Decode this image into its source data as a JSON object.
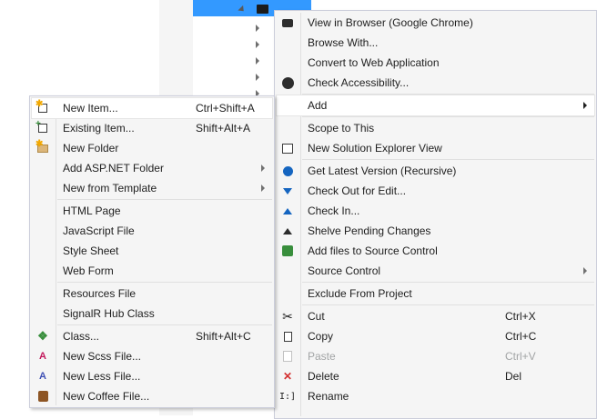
{
  "context_menu": {
    "items": [
      {
        "label": "View in Browser (Google Chrome)",
        "icon": "browser-icon"
      },
      {
        "label": "Browse With..."
      },
      {
        "label": "Convert to Web Application"
      },
      {
        "label": "Check Accessibility...",
        "icon": "accessibility-icon"
      },
      {
        "label": "Add",
        "has_submenu": true,
        "highlighted": true
      },
      {
        "label": "Scope to This"
      },
      {
        "label": "New Solution Explorer View",
        "icon": "new-view-icon"
      },
      {
        "label": "Get Latest Version (Recursive)",
        "icon": "get-latest-icon"
      },
      {
        "label": "Check Out for Edit...",
        "icon": "check-out-icon"
      },
      {
        "label": "Check In...",
        "icon": "check-in-icon"
      },
      {
        "label": "Shelve Pending Changes",
        "icon": "shelve-icon"
      },
      {
        "label": "Add files to Source Control",
        "icon": "add-source-control-icon"
      },
      {
        "label": "Source Control",
        "has_submenu": true
      },
      {
        "label": "Exclude From Project"
      },
      {
        "label": "Cut",
        "shortcut": "Ctrl+X",
        "icon": "scissors-icon"
      },
      {
        "label": "Copy",
        "shortcut": "Ctrl+C",
        "icon": "copy-icon"
      },
      {
        "label": "Paste",
        "shortcut": "Ctrl+V",
        "icon": "paste-icon",
        "disabled": true
      },
      {
        "label": "Delete",
        "shortcut": "Del",
        "icon": "delete-icon"
      },
      {
        "label": "Rename",
        "icon": "rename-icon"
      }
    ]
  },
  "add_submenu": {
    "items": [
      {
        "label": "New Item...",
        "shortcut": "Ctrl+Shift+A",
        "icon": "new-item-icon",
        "highlighted": true
      },
      {
        "label": "Existing Item...",
        "shortcut": "Shift+Alt+A",
        "icon": "existing-item-icon"
      },
      {
        "label": "New Folder",
        "icon": "new-folder-icon"
      },
      {
        "label": "Add ASP.NET Folder",
        "has_submenu": true
      },
      {
        "label": "New from Template",
        "has_submenu": true
      },
      {
        "label": "HTML Page"
      },
      {
        "label": "JavaScript File"
      },
      {
        "label": "Style Sheet"
      },
      {
        "label": "Web Form"
      },
      {
        "label": "Resources File"
      },
      {
        "label": "SignalR Hub Class"
      },
      {
        "label": "Class...",
        "shortcut": "Shift+Alt+C",
        "icon": "class-icon"
      },
      {
        "label": "New Scss File...",
        "icon": "scss-file-icon"
      },
      {
        "label": "New Less File...",
        "icon": "less-file-icon"
      },
      {
        "label": "New Coffee File...",
        "icon": "coffee-file-icon"
      }
    ]
  },
  "colors": {
    "selection_blue": "#3399ff",
    "menu_background": "#f5f5f5",
    "menu_border": "#cccedb",
    "disabled_text": "#a2a4a5",
    "delete_red": "#d32f2f"
  }
}
